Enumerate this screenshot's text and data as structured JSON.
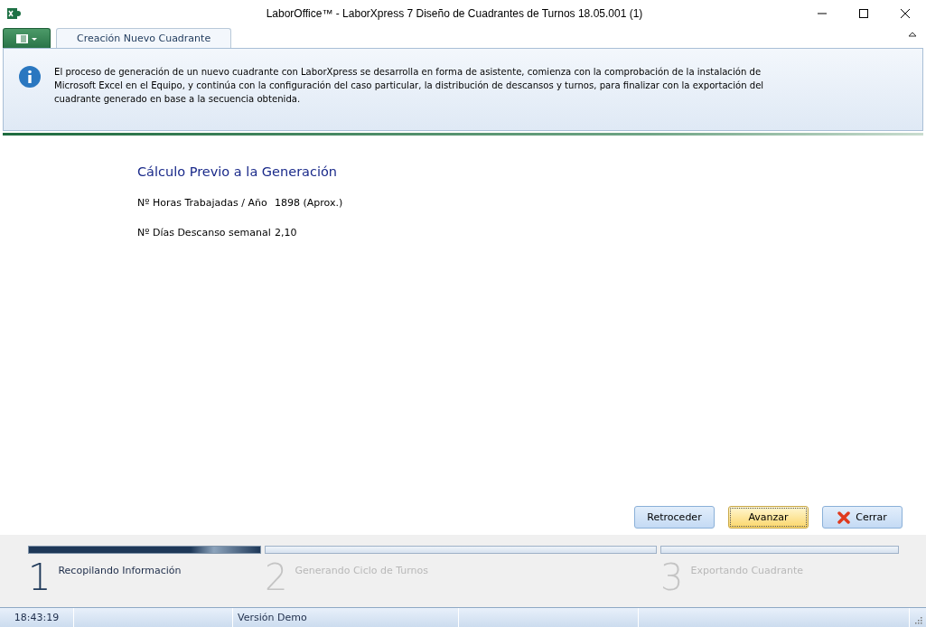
{
  "window": {
    "title": "LaborOffice™ - LaborXpress 7 Diseño de Cuadrantes de Turnos 18.05.001 (1)"
  },
  "tabs": [
    {
      "label": "Creación Nuevo Cuadrante",
      "selected": true
    }
  ],
  "info": {
    "text": "El proceso de generación de un nuevo cuadrante con LaborXpress se desarrolla en forma de asistente, comienza con la comprobación de la instalación de Microsoft Excel en el Equipo, y continúa con la configuración del caso particular, la distribución de descansos y turnos, para finalizar con la exportación del cuadrante generado en base a la secuencia obtenida."
  },
  "section": {
    "title": "Cálculo Previo a la Generación",
    "fields": [
      {
        "label": "Nº Horas Trabajadas / Año",
        "value": "1898 (Aprox.)"
      },
      {
        "label": "Nº Días Descanso semanal",
        "value": "2,10"
      }
    ]
  },
  "buttons": [
    {
      "label": "Retroceder",
      "kind": "plain"
    },
    {
      "label": "Avanzar",
      "kind": "default"
    },
    {
      "label": "Cerrar",
      "kind": "close"
    }
  ],
  "steps": [
    {
      "number": "1",
      "label": "Recopilando Información",
      "selected": true
    },
    {
      "number": "2",
      "label": "Generando Ciclo de Turnos",
      "selected": false
    },
    {
      "number": "3",
      "label": "Exportando Cuadrante",
      "selected": false
    }
  ],
  "status_bar": {
    "time": "18:43:19",
    "version": "Versión Demo"
  }
}
